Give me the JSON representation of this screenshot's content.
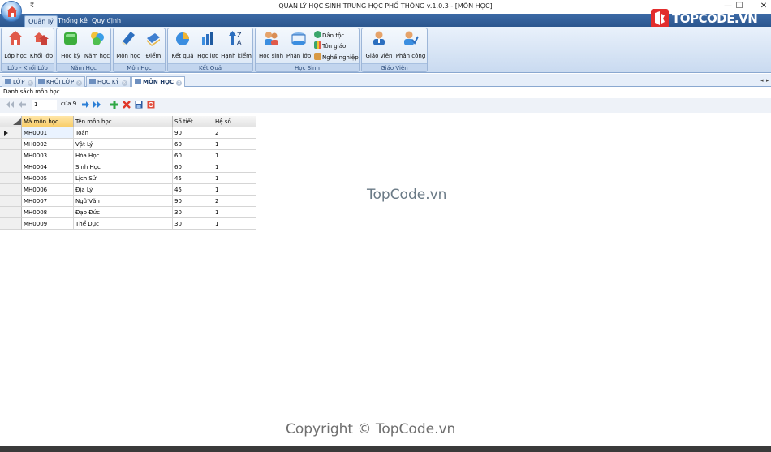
{
  "window": {
    "title": "QUẢN LÝ HỌC SINH TRUNG HỌC PHỔ THÔNG v.1.0.3 - [MÔN HỌC]",
    "pin_glyph": "₹",
    "controls": [
      "—",
      "☐",
      "✕"
    ]
  },
  "logo": {
    "text": "TOPCODE.VN",
    "colors": {
      "mark": "#e22d2d",
      "text": "#ffffff"
    }
  },
  "ribbon": {
    "tabs": [
      {
        "label": "Quản lý",
        "active": true
      },
      {
        "label": "Thống kê",
        "active": false
      },
      {
        "label": "Quy định",
        "active": false
      }
    ],
    "groups": [
      {
        "label": "Lớp - Khối Lớp",
        "buttons": [
          {
            "label": "Lớp học",
            "icon": "house-icon"
          },
          {
            "label": "Khối lớp",
            "icon": "houses-icon"
          }
        ]
      },
      {
        "label": "Năm Học",
        "buttons": [
          {
            "label": "Học kỳ",
            "icon": "green-box-icon"
          },
          {
            "label": "Năm học",
            "icon": "cubes-icon"
          }
        ]
      },
      {
        "label": "Môn Học",
        "buttons": [
          {
            "label": "Môn học",
            "icon": "book-icon"
          },
          {
            "label": "Điểm",
            "icon": "notebook-icon"
          }
        ]
      },
      {
        "label": "Kết Quả",
        "buttons": [
          {
            "label": "Kết quả",
            "icon": "pie-chart-icon"
          },
          {
            "label": "Học lực",
            "icon": "bar-chart-icon"
          },
          {
            "label": "Hạnh kiểm",
            "icon": "sort-az-icon"
          }
        ]
      },
      {
        "label": "Học Sinh",
        "buttons": [
          {
            "label": "Học sinh",
            "icon": "students-icon"
          },
          {
            "label": "Phân lớp",
            "icon": "assign-class-icon"
          }
        ],
        "small_buttons": [
          {
            "label": "Dân tộc",
            "icon": "globe-icon"
          },
          {
            "label": "Tôn giáo",
            "icon": "flag-icon"
          },
          {
            "label": "Nghề nghiệp",
            "icon": "briefcase-icon"
          }
        ]
      },
      {
        "label": "Giáo Viên",
        "buttons": [
          {
            "label": "Giáo viên",
            "icon": "teacher-icon"
          },
          {
            "label": "Phân công",
            "icon": "assign-teacher-icon"
          }
        ]
      }
    ]
  },
  "doc_tabs": [
    {
      "label": "LỚP",
      "active": false
    },
    {
      "label": "KHỐI LỚP",
      "active": false
    },
    {
      "label": "HỌC KỲ",
      "active": false
    },
    {
      "label": "MÔN HỌC",
      "active": true
    }
  ],
  "panel_title": "Danh sách môn học",
  "navigator": {
    "position": "1",
    "of_label": "của 9"
  },
  "grid": {
    "columns": [
      "Mã môn học",
      "Tên môn học",
      "Số tiết",
      "Hệ số"
    ],
    "rows": [
      [
        "MH0001",
        "Toán",
        "90",
        "2"
      ],
      [
        "MH0002",
        "Vật Lý",
        "60",
        "1"
      ],
      [
        "MH0003",
        "Hóa Học",
        "60",
        "1"
      ],
      [
        "MH0004",
        "Sinh Học",
        "60",
        "1"
      ],
      [
        "MH0005",
        "Lịch Sử",
        "45",
        "1"
      ],
      [
        "MH0006",
        "Địa Lý",
        "45",
        "1"
      ],
      [
        "MH0007",
        "Ngữ Văn",
        "90",
        "2"
      ],
      [
        "MH0008",
        "Đạo Đức",
        "30",
        "1"
      ],
      [
        "MH0009",
        "Thể Dục",
        "30",
        "1"
      ]
    ]
  },
  "watermarks": {
    "center": "TopCode.vn",
    "bottom": "Copyright © TopCode.vn"
  }
}
